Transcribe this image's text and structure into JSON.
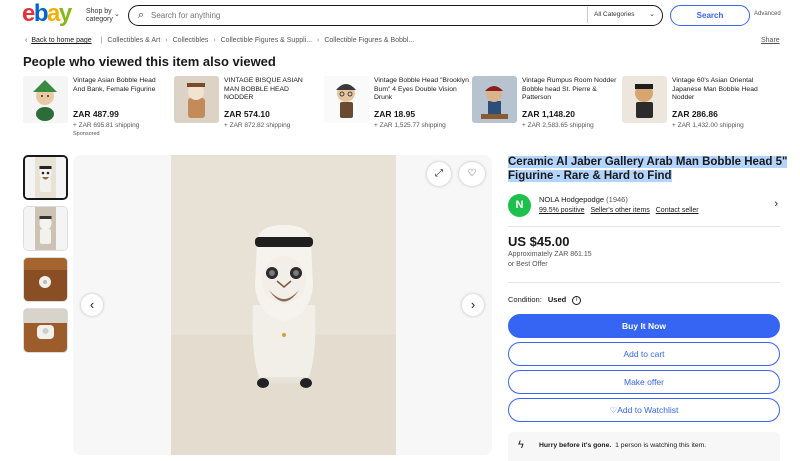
{
  "header": {
    "logo": [
      "e",
      "b",
      "a",
      "y"
    ],
    "shop_by_category": "Shop by category",
    "search_placeholder": "Search for anything",
    "category_select": "All Categories",
    "search_button": "Search",
    "advanced": "Advanced"
  },
  "breadcrumb": {
    "back": "Back to home page",
    "items": [
      "Collectibles & Art",
      "Collectibles",
      "Collectible Figures & Suppli...",
      "Collectible Figures & Bobbl..."
    ],
    "share": "Share"
  },
  "viewed": {
    "title": "People who viewed this item also viewed",
    "items": [
      {
        "title": "Vintage Asian Bobble Head And Bank, Female Figurine",
        "price": "ZAR 487.99",
        "shipping": "+ ZAR 695.81 shipping",
        "sponsored": "Sponsored"
      },
      {
        "title": "VINTAGE BISQUE ASIAN MAN BOBBLE HEAD NODDER",
        "price": "ZAR 574.10",
        "shipping": "+ ZAR 872.82 shipping",
        "sponsored": ""
      },
      {
        "title": "Vintage Bobble Head \"Brooklyn Bum\" 4 Eyes Double Vision Drunk",
        "price": "ZAR 18.95",
        "shipping": "+ ZAR 1,525.77 shipping",
        "sponsored": ""
      },
      {
        "title": "Vintage Rumpus Room Nodder Bobble head St. Pierre & Patterson",
        "price": "ZAR 1,148.20",
        "shipping": "+ ZAR 2,583.65 shipping",
        "sponsored": ""
      },
      {
        "title": "Vintage 60's Asian Oriental Japanese Man Bobble Head Nodder",
        "price": "ZAR 286.86",
        "shipping": "+ ZAR 1,432.00 shipping",
        "sponsored": ""
      }
    ]
  },
  "gallery": {
    "prev_icon": "chevron-left-icon",
    "next_icon": "chevron-right-icon",
    "expand_icon": "expand-icon",
    "watch_icon": "heart-icon"
  },
  "item": {
    "title": "Ceramic Al Jaber Gallery Arab Man Bobble Head 5\" Figurine - Rare & Hard to Find",
    "seller_initial": "N",
    "seller_name": "NOLA Hodgepodge",
    "seller_feedback": "(1946)",
    "seller_positive": "99.5% positive",
    "seller_other_items": "Seller's other items",
    "seller_contact": "Contact seller",
    "price": "US $45.00",
    "price_approx": "Approximately ZAR 861.15",
    "best_offer": "or Best Offer",
    "condition_label": "Condition:",
    "condition_value": "Used",
    "buy_now": "Buy It Now",
    "add_to_cart": "Add to cart",
    "make_offer": "Make offer",
    "add_to_watchlist": "Add to Watchlist",
    "hurry_bold": "Hurry before it's gone.",
    "hurry_text": "1 person is watching this item."
  },
  "colors": {
    "accent": "#3665f3",
    "seller_avatar": "#1dbf4d",
    "title_highlight": "#b3d4fc"
  }
}
